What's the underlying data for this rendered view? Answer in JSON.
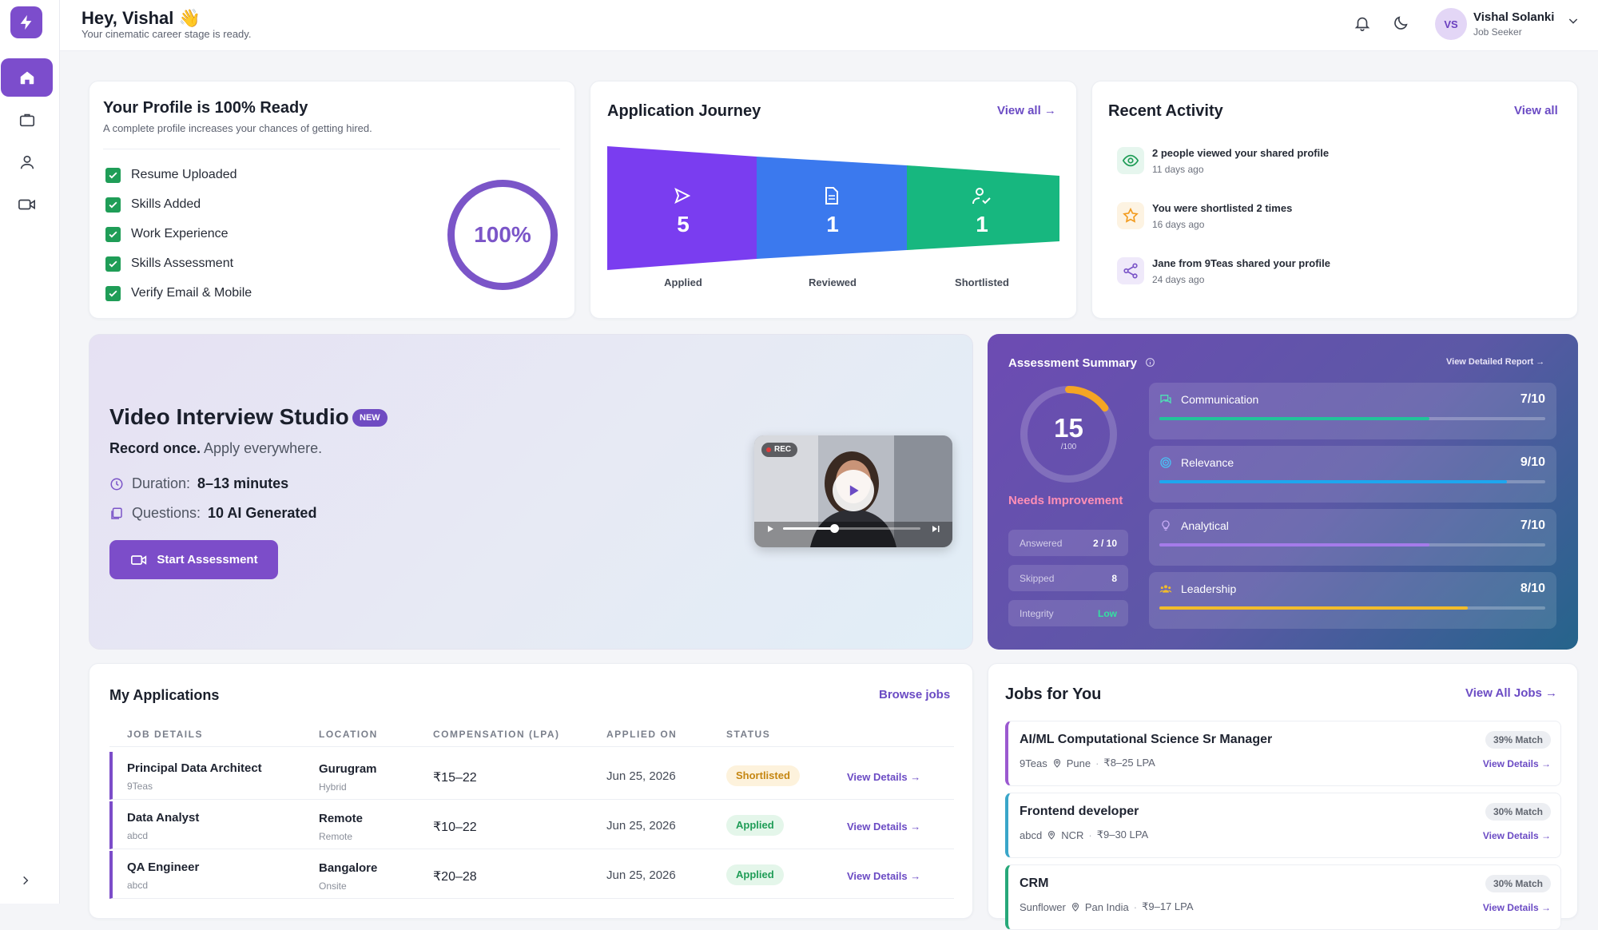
{
  "header": {
    "greeting": "Hey, Vishal 👋",
    "subtitle": "Your cinematic career stage is ready.",
    "user_initials": "VS",
    "user_name": "Vishal Solanki",
    "user_role": "Job Seeker"
  },
  "profile": {
    "title": "Your Profile is 100% Ready",
    "subtitle": "A complete profile increases your chances of getting hired.",
    "percent": "100%",
    "items": [
      "Resume Uploaded",
      "Skills Added",
      "Work Experience",
      "Skills Assessment",
      "Verify Email & Mobile"
    ]
  },
  "journey": {
    "title": "Application Journey",
    "view_all": "View all →",
    "stages": [
      {
        "label": "Applied",
        "value": "5"
      },
      {
        "label": "Reviewed",
        "value": "1"
      },
      {
        "label": "Shortlisted",
        "value": "1"
      }
    ]
  },
  "activity": {
    "title": "Recent Activity",
    "view_all": "View all",
    "items": [
      {
        "title": "2 people viewed your shared profile",
        "time": "11 days ago",
        "icon": "eye-icon"
      },
      {
        "title": "You were shortlisted 2 times",
        "time": "16 days ago",
        "icon": "star-icon"
      },
      {
        "title": "Jane from 9Teas shared your profile",
        "time": "24 days ago",
        "icon": "share-icon"
      }
    ]
  },
  "video": {
    "title": "Video Interview Studio",
    "badge": "NEW",
    "tagline_bold": "Record once.",
    "tagline": " Apply everywhere.",
    "duration_label": "Duration:",
    "duration": "8–13 minutes",
    "questions_label": "Questions:",
    "questions": "10 AI Generated",
    "button": "Start Assessment",
    "rec": "REC",
    "progress": 0.38
  },
  "assessment": {
    "title": "Assessment Summary",
    "link": "View Detailed Report →",
    "score": "15",
    "score_of": "/100",
    "score_fraction": 0.15,
    "verdict": "Needs Improvement",
    "stats": [
      {
        "k": "Answered",
        "v": "2 / 10"
      },
      {
        "k": "Skipped",
        "v": "8"
      },
      {
        "k": "Integrity",
        "v": "Low"
      }
    ],
    "skills": [
      {
        "name": "Communication",
        "score": "7/10",
        "value": 0.7,
        "color": "#22c39a"
      },
      {
        "name": "Relevance",
        "score": "9/10",
        "value": 0.9,
        "color": "#1ea7ef"
      },
      {
        "name": "Analytical",
        "score": "7/10",
        "value": 0.7,
        "color": "#a57bea"
      },
      {
        "name": "Leadership",
        "score": "8/10",
        "value": 0.8,
        "color": "#f2bc2b"
      }
    ]
  },
  "applications": {
    "title": "My Applications",
    "browse": "Browse jobs",
    "columns": [
      "JOB DETAILS",
      "LOCATION",
      "COMPENSATION (LPA)",
      "APPLIED ON",
      "STATUS"
    ],
    "rows": [
      {
        "role": "Principal Data Architect",
        "company": "9Teas",
        "location": "Gurugram",
        "mode": "Hybrid",
        "comp": "₹15–22",
        "date": "Jun 25, 2026",
        "status": "Shortlisted",
        "action": "View Details →"
      },
      {
        "role": "Data Analyst",
        "company": "abcd",
        "location": "Remote",
        "mode": "Remote",
        "comp": "₹10–22",
        "date": "Jun 25, 2026",
        "status": "Applied",
        "action": "View Details →"
      },
      {
        "role": "QA Engineer",
        "company": "abcd",
        "location": "Bangalore",
        "mode": "Onsite",
        "comp": "₹20–28",
        "date": "Jun 25, 2026",
        "status": "Applied",
        "action": "View Details →"
      }
    ]
  },
  "jobs": {
    "title": "Jobs for You",
    "view_all": "View All Jobs →",
    "items": [
      {
        "title": "AI/ML Computational Science Sr Manager",
        "company": "9Teas",
        "location": "Pune",
        "salary": "₹8–25 LPA",
        "match": "39% Match",
        "action": "View Details →",
        "accent": "#9b59d0"
      },
      {
        "title": "Frontend developer",
        "company": "abcd",
        "location": "NCR",
        "salary": "₹9–30 LPA",
        "match": "30% Match",
        "action": "View Details →",
        "accent": "#3aa6c9"
      },
      {
        "title": "CRM",
        "company": "Sunflower",
        "location": "Pan India",
        "salary": "₹9–17 LPA",
        "match": "30% Match",
        "action": "View Details →",
        "accent": "#27a879"
      }
    ]
  }
}
